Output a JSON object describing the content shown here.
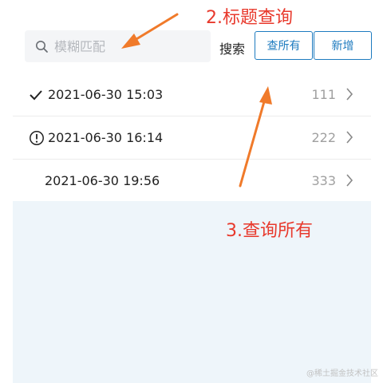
{
  "search": {
    "placeholder": "模糊匹配",
    "value": "",
    "label": "搜索"
  },
  "buttons": {
    "query_all": "查所有",
    "add": "新增"
  },
  "list": [
    {
      "status": "check",
      "time": "2021-06-30 15:03",
      "count": "111"
    },
    {
      "status": "alert",
      "time": "2021-06-30 16:14",
      "count": "222"
    },
    {
      "status": "none",
      "time": "2021-06-30 19:56",
      "count": "333"
    }
  ],
  "annotations": {
    "title_query": "2.标题查询",
    "query_all": "3.查询所有"
  },
  "watermark": "@稀土掘金技术社区",
  "colors": {
    "accent": "#1e7bbf",
    "annotation_text": "#e8392c",
    "arrow": "#f07a2a",
    "empty_area": "#eef5fa",
    "search_bg": "#f4f5f7"
  }
}
